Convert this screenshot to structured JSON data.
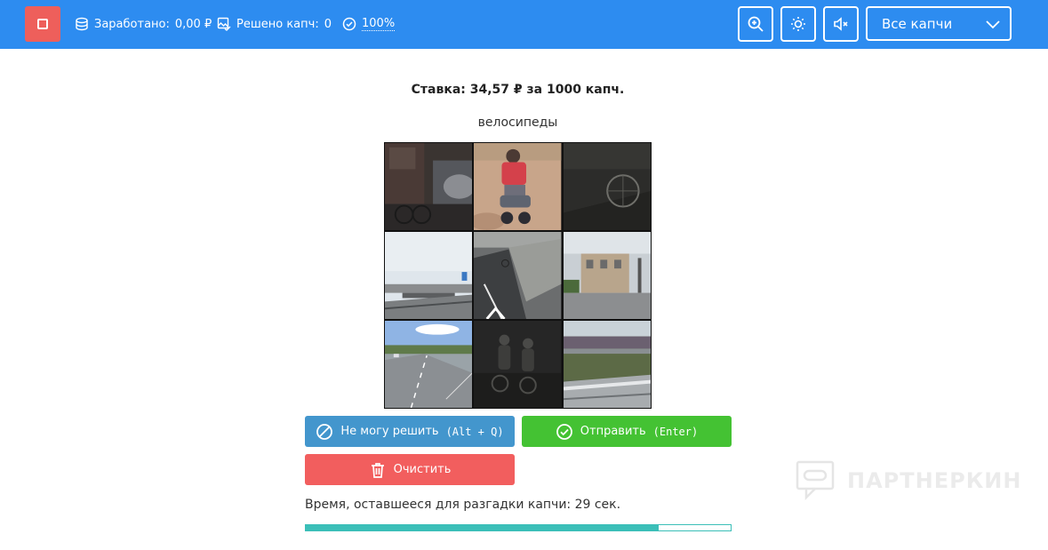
{
  "header": {
    "stats": {
      "earned_label": "Заработано:",
      "earned_value": "0,00 ₽",
      "solved_label": "Решено капч:",
      "solved_value": "0",
      "accuracy_value": "100%"
    },
    "filter": {
      "selected": "Все капчи"
    },
    "icons": [
      "stop-icon",
      "coins-icon",
      "image-check-icon",
      "check-circle-icon",
      "zoom-icon",
      "brightness-icon",
      "mute-icon",
      "chevron-down-icon"
    ]
  },
  "main": {
    "rate": "Ставка: 34,57 ₽ за 1000 капч.",
    "task": "велосипеды",
    "tiles": [
      "tile-1",
      "tile-2",
      "tile-3",
      "tile-4",
      "tile-5",
      "tile-6",
      "tile-7",
      "tile-8",
      "tile-9"
    ],
    "buttons": {
      "cant_solve_label": "Не могу решить",
      "cant_solve_hotkey": "(Alt + Q)",
      "submit_label": "Отправить",
      "submit_hotkey": "(Enter)",
      "clear_label": "Очистить"
    },
    "timer": {
      "text": "Время, оставшееся для разгадки капчи: 29 сек.",
      "progress_percent": 83
    }
  },
  "watermark": {
    "text": "ПАРТНЕРКИН"
  },
  "colors": {
    "header_bg": "#2d8cf0",
    "stop_button": "#ee5f5b",
    "cant_solve_button": "#4396cd",
    "submit_button": "#44c233",
    "clear_button": "#f25e5e",
    "progress": "#3bbfb8"
  }
}
